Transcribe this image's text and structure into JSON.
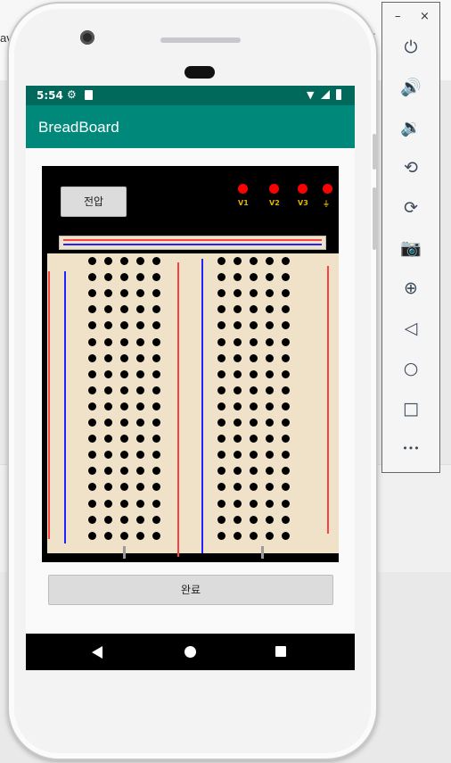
{
  "desktop": {
    "left_fragment": "av",
    "right_fragment": "vi"
  },
  "status_bar": {
    "time": "5:54",
    "icons": [
      "gear-icon",
      "sd-card-icon",
      "wifi-icon",
      "signal-icon",
      "battery-icon"
    ]
  },
  "app_bar": {
    "title": "BreadBoard"
  },
  "breadboard": {
    "voltage_button_label": "전압",
    "terminals": [
      {
        "label": "V1"
      },
      {
        "label": "V2"
      },
      {
        "label": "V3"
      },
      {
        "label": "⏚"
      }
    ],
    "hole_grid": {
      "groups": 2,
      "columns_per_group": 5,
      "rows": 18
    },
    "colors": {
      "board": "#f0e1c9",
      "red_line": "#ff4040",
      "blue_line": "#2222ff",
      "terminal": "#ff0000"
    }
  },
  "done_button_label": "완료",
  "nav_bar": {
    "icons": [
      "back-icon",
      "home-icon",
      "recents-icon"
    ]
  },
  "emulator_panel": {
    "window_buttons": [
      "–",
      "×"
    ],
    "items": [
      {
        "name": "power-icon",
        "glyph": "⏻"
      },
      {
        "name": "volume-up-icon",
        "glyph": "🔊"
      },
      {
        "name": "volume-down-icon",
        "glyph": "🔉"
      },
      {
        "name": "rotate-left-icon",
        "glyph": "⟲"
      },
      {
        "name": "rotate-right-icon",
        "glyph": "⟳"
      },
      {
        "name": "camera-icon",
        "glyph": "📷"
      },
      {
        "name": "zoom-icon",
        "glyph": "⊕"
      },
      {
        "name": "back-icon",
        "glyph": "◁"
      },
      {
        "name": "home-icon",
        "glyph": "○"
      },
      {
        "name": "overview-icon",
        "glyph": "□"
      },
      {
        "name": "more-icon",
        "glyph": "•••"
      }
    ]
  }
}
